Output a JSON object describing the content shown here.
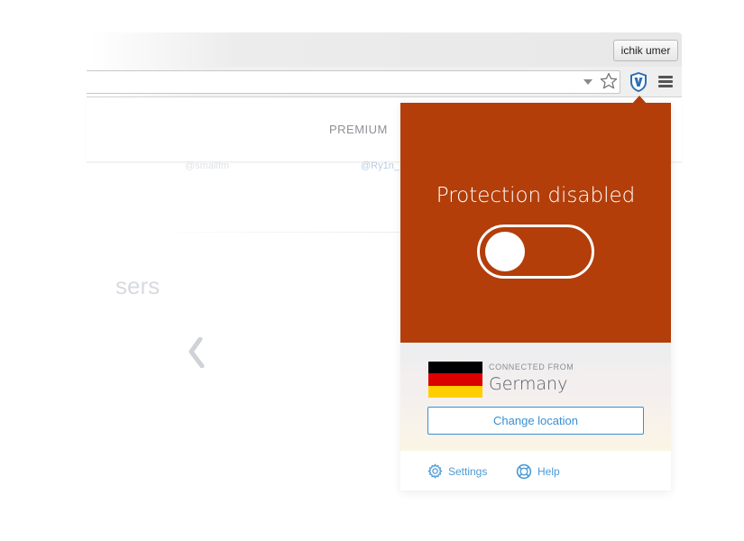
{
  "browser": {
    "profile_name": "ichik umer"
  },
  "page": {
    "nav": {
      "premium_label": "PREMIUM"
    },
    "handles": [
      "@smallfm",
      "@Ry1n_"
    ],
    "users_heading": "sers"
  },
  "popup": {
    "status": "Protection disabled",
    "protection_enabled": false,
    "location": {
      "connected_label": "CONNECTED FROM",
      "country": "Germany",
      "change_button": "Change location"
    },
    "footer": {
      "settings_label": "Settings",
      "help_label": "Help"
    }
  },
  "icons": {
    "bookmark": "star-icon",
    "extension": "shield-v-icon",
    "menu": "hamburger-icon",
    "settings": "gear-icon",
    "help": "lifebuoy-icon"
  },
  "colors": {
    "status_panel": "#b33e0a",
    "link_blue": "#3a8fd1",
    "flag_black": "#000000",
    "flag_red": "#dd0000",
    "flag_gold": "#ffce00"
  }
}
